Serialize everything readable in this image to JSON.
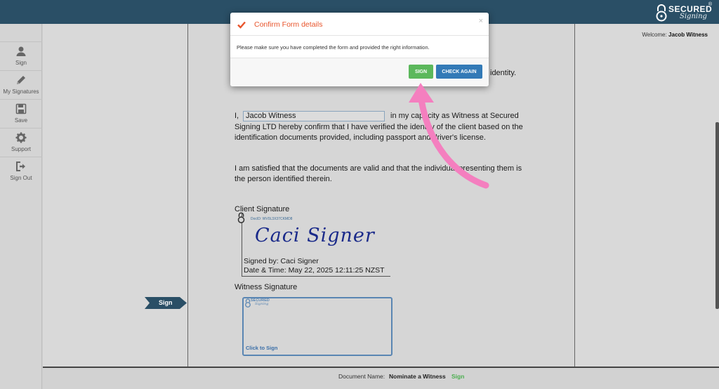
{
  "header": {
    "logo_text": "SECURED",
    "logo_sub": "Signing",
    "logo_reg": "®"
  },
  "sidebar": {
    "items": [
      {
        "label": "Sign",
        "icon": "user-icon"
      },
      {
        "label": "My Signatures",
        "icon": "pencil-icon"
      },
      {
        "label": "Save",
        "icon": "floppy-disk-icon"
      },
      {
        "label": "Support",
        "icon": "gear-icon"
      },
      {
        "label": "Sign Out",
        "icon": "sign-out-icon"
      }
    ]
  },
  "welcome": {
    "prefix": "Welcome:",
    "user": "Jacob Witness"
  },
  "document": {
    "identity_tail": "identity.",
    "para1_prefix": "I,",
    "witness_name": "Jacob Witness",
    "para1_line1": "in my capacity as Witness at Secured",
    "para1_line2": "Signing LTD hereby confirm that I have verified the identity of the client based on the",
    "para1_line3": "identification documents provided, including passport and driver's license.",
    "para2_line1": "I am satisfied that the documents are valid and that the individual presenting them is",
    "para2_line2": "the person identified therein.",
    "client_sig_label": "Client Signature",
    "client_doc_id": "DocID: WV0L3X37CKMD8",
    "client_sig_script": "Caci Signer",
    "client_signed_by": "Signed by: Caci Signer",
    "client_signed_date": "Date & Time: May 22, 2025 12:11:25 NZST",
    "witness_sig_label": "Witness Signature",
    "witness_click": "Click to Sign",
    "mini_logo": "SECURED",
    "mini_logo_sub": "Signing"
  },
  "sign_tab": {
    "label": "Sign"
  },
  "footer": {
    "doc_label": "Document Name:",
    "doc_name": "Nominate a Witness",
    "sign_link": "Sign"
  },
  "modal": {
    "title": "Confirm Form details",
    "body": "Please make sure you have completed the form and provided the right information.",
    "close": "×",
    "sign_button": "SIGN",
    "check_button": "CHECK AGAIN"
  },
  "colors": {
    "topbar": "#2a4f66",
    "modal_title": "#e8542b",
    "sign_green": "#5cb85c",
    "check_blue": "#337ab7",
    "arrow_pink": "#f47fbf"
  }
}
